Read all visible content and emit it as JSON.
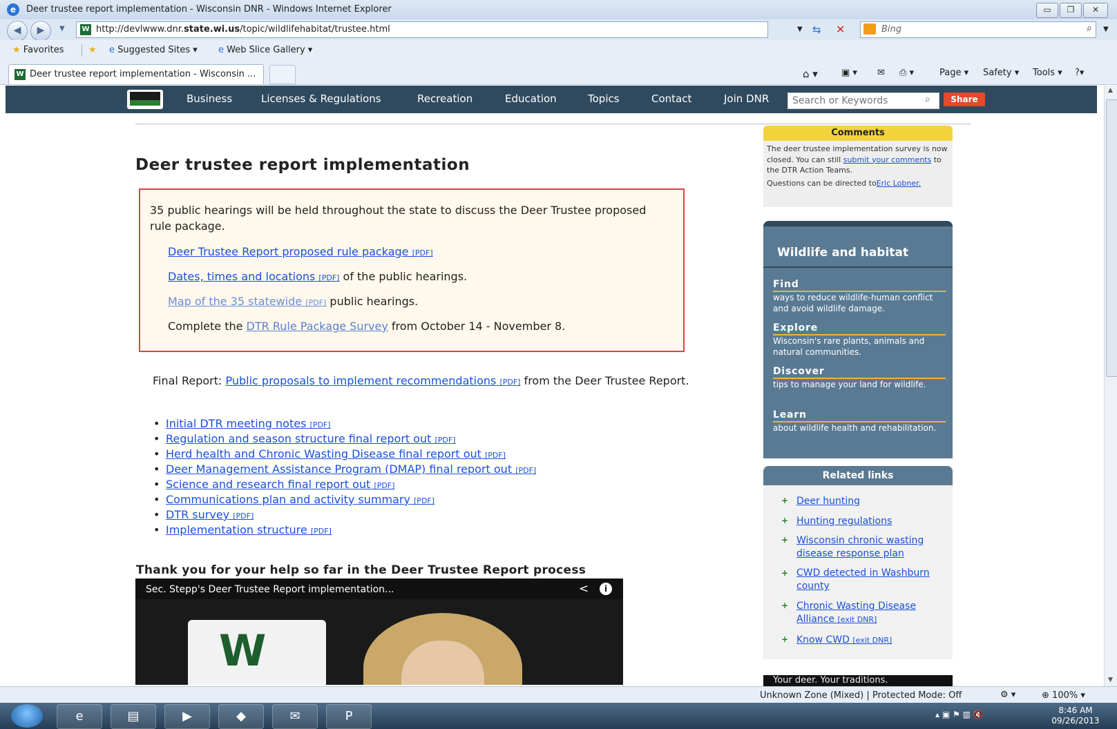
{
  "window": {
    "title": "Deer trustee report implementation - Wisconsin DNR - Windows Internet Explorer"
  },
  "addressbar": {
    "url_prefix": "http://devlwww.dnr.",
    "url_domain": "state.wi.us",
    "url_path": "/topic/wildlifehabitat/trustee.html",
    "search_placeholder": "Bing"
  },
  "favorites_bar": {
    "favorites_label": "Favorites",
    "items": [
      "Suggested Sites",
      "Web Slice Gallery"
    ]
  },
  "tabs": {
    "active_tab": "Deer trustee report implementation - Wisconsin ..."
  },
  "command_bar": {
    "page": "Page",
    "safety": "Safety",
    "tools": "Tools"
  },
  "site_nav": {
    "items": [
      "Business",
      "Licenses & Regulations",
      "Recreation",
      "Education",
      "Topics",
      "Contact",
      "Join DNR"
    ],
    "search_placeholder": "Search or Keywords",
    "share_label": "Share"
  },
  "main": {
    "title": "Deer trustee report implementation",
    "notice": {
      "intro": "35 public hearings will be held throughout the state to discuss the Deer Trustee proposed rule package.",
      "link1": "Deer Trustee Report proposed rule package",
      "link2": "Dates, times and locations",
      "link2_suffix": " of the public hearings.",
      "link3": "Map of the 35 statewide",
      "link3_suffix": " public hearings.",
      "line4_prefix": "Complete the ",
      "link4": "DTR Rule Package Survey",
      "line4_suffix": " from October 14 - November 8.",
      "pdf_tag": "[PDF]"
    },
    "final_report": {
      "prefix": "Final Report: ",
      "link": "Public proposals to implement recommendations",
      "suffix": " from the Deer Trustee Report."
    },
    "reports": [
      "Initial DTR meeting notes",
      "Regulation and season structure final report out",
      "Herd health and Chronic Wasting Disease final report out",
      "Deer Management Assistance Program (DMAP) final report out",
      "Science and research final report out",
      "Communications plan and activity summary",
      "DTR survey",
      "Implementation structure"
    ],
    "thanks_heading": "Thank you for your help so far in the Deer Trustee Report process",
    "video_title": "Sec. Stepp's Deer Trustee Report implementation..."
  },
  "sidebar": {
    "comments": {
      "heading": "Comments",
      "text1": "The deer trustee implementation survey is now closed. You can still ",
      "link1": "submit your comments",
      "text2": " to the DTR Action Teams.",
      "text3": "Questions can be directed to ",
      "link2": "Eric Lobner."
    },
    "wildlife": {
      "heading": "Wildlife and habitat",
      "sections": [
        {
          "title": "Find",
          "desc": "ways to reduce wildlife-human conflict and avoid wildlife damage."
        },
        {
          "title": "Explore",
          "desc": "Wisconsin's rare plants, animals and natural communities."
        },
        {
          "title": "Discover",
          "desc": "tips to manage your land for wildlife."
        },
        {
          "title": "Learn",
          "desc": "about wildlife health and rehabilitation."
        }
      ]
    },
    "related": {
      "heading": "Related links",
      "links": [
        {
          "label": "Deer hunting",
          "exit": ""
        },
        {
          "label": "Hunting regulations",
          "exit": ""
        },
        {
          "label": "Wisconsin chronic wasting disease response plan",
          "exit": ""
        },
        {
          "label": "CWD detected in Washburn county",
          "exit": ""
        },
        {
          "label": "Chronic Wasting Disease Alliance",
          "exit": "[exit DNR]"
        },
        {
          "label": "Know CWD",
          "exit": "[exit DNR]"
        }
      ]
    },
    "video_strip": "Your deer. Your traditions."
  },
  "statusbar": {
    "zone": "Unknown Zone (Mixed) | Protected Mode: Off",
    "zoom": "100%"
  },
  "taskbar": {
    "time": "8:46 AM",
    "date": "09/26/2013"
  }
}
